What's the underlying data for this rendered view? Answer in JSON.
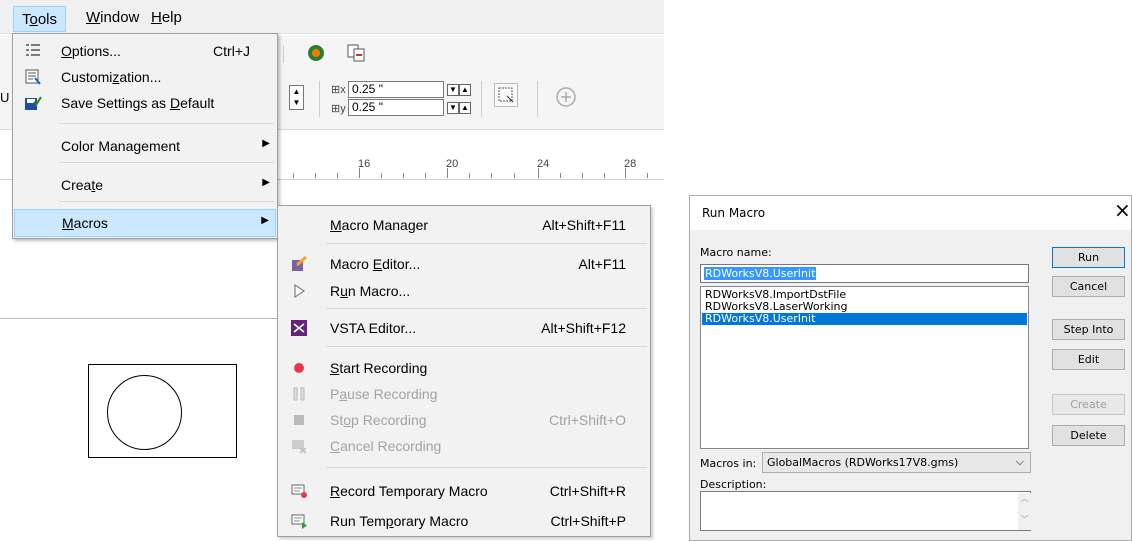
{
  "menubar": {
    "items": [
      {
        "label": "Tools",
        "key": "o"
      },
      {
        "label": "Window",
        "key": "W"
      },
      {
        "label": "Help",
        "key": "H"
      }
    ]
  },
  "toolbar": {
    "offset_x": "0.25 \"",
    "offset_y": "0.25 \""
  },
  "ruler": {
    "labels": [
      "16",
      "20",
      "24",
      "28"
    ]
  },
  "tools_menu": {
    "items": [
      {
        "label": "Options...",
        "shortcut": "Ctrl+J",
        "icon": "options-icon"
      },
      {
        "label": "Customization...",
        "shortcut": "",
        "icon": "customization-icon"
      },
      {
        "label": "Save Settings as Default",
        "shortcut": "",
        "icon": "save-settings-icon"
      },
      {
        "label": "Color Management",
        "shortcut": "",
        "submenu": true
      },
      {
        "label": "Create",
        "shortcut": "",
        "submenu": true
      },
      {
        "label": "Macros",
        "shortcut": "",
        "submenu": true,
        "highlighted": true
      }
    ]
  },
  "macros_menu": {
    "items": [
      {
        "label": "Macro Manager",
        "shortcut": "Alt+Shift+F11",
        "enabled": true
      },
      {
        "label": "Macro Editor...",
        "shortcut": "Alt+F11",
        "enabled": true,
        "icon": "macro-editor-icon"
      },
      {
        "label": "Run Macro...",
        "shortcut": "",
        "enabled": true,
        "icon": "play-icon"
      },
      {
        "label": "VSTA Editor...",
        "shortcut": "Alt+Shift+F12",
        "enabled": true,
        "icon": "vsta-icon"
      },
      {
        "label": "Start Recording",
        "shortcut": "",
        "enabled": true,
        "icon": "record-icon"
      },
      {
        "label": "Pause Recording",
        "shortcut": "",
        "enabled": false,
        "icon": "pause-icon"
      },
      {
        "label": "Stop Recording",
        "shortcut": "Ctrl+Shift+O",
        "enabled": false,
        "icon": "stop-icon"
      },
      {
        "label": "Cancel Recording",
        "shortcut": "",
        "enabled": false,
        "icon": "cancel-recording-icon"
      },
      {
        "label": "Record Temporary Macro",
        "shortcut": "Ctrl+Shift+R",
        "enabled": true,
        "icon": "record-temp-icon"
      },
      {
        "label": "Run Temporary Macro",
        "shortcut": "Ctrl+Shift+P",
        "enabled": true,
        "icon": "run-temp-icon"
      }
    ]
  },
  "dialog": {
    "title": "Run Macro",
    "macro_name_label": "Macro name:",
    "macro_name_value": "RDWorksV8.UserInit",
    "macro_list": [
      "RDWorksV8.ImportDstFile",
      "RDWorksV8.LaserWorking",
      "RDWorksV8.UserInit"
    ],
    "selected_index": 2,
    "buttons": {
      "run": "Run",
      "cancel": "Cancel",
      "step_into": "Step Into",
      "edit": "Edit",
      "create": "Create",
      "delete": "Delete"
    },
    "macros_in_label": "Macros in:",
    "macros_in_value": "GlobalMacros (RDWorks17V8.gms)",
    "description_label": "Description:",
    "description_value": ""
  },
  "colors": {
    "menu_highlight": "#cce8ff",
    "selection": "#0078d7"
  }
}
